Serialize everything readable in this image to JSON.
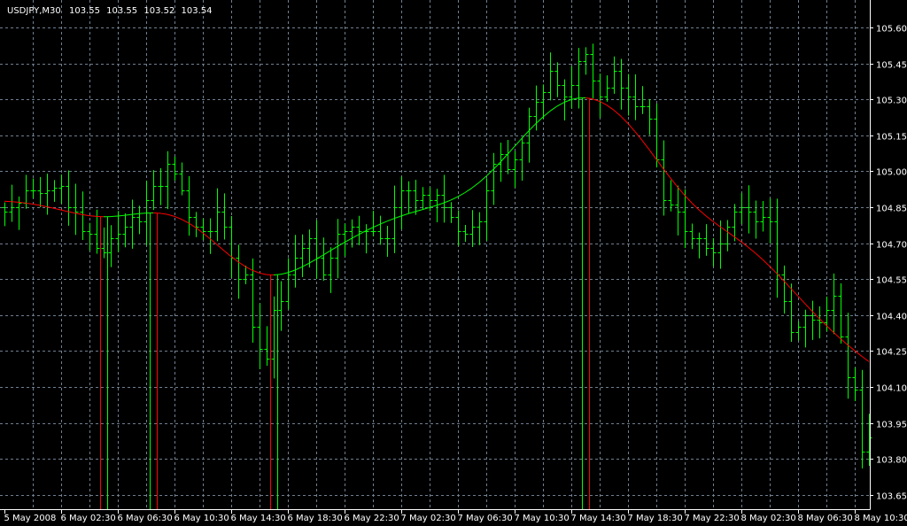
{
  "header": {
    "symbol": "USDJPY,M30",
    "open": "103.55",
    "high": "103.55",
    "low": "103.52",
    "close": "103.54"
  },
  "chart_data": {
    "type": "bar",
    "title": "USDJPY,M30",
    "ylim": [
      103.6,
      105.65
    ],
    "y_ticks": [
      "105.60",
      "105.45",
      "105.30",
      "105.15",
      "105.00",
      "104.85",
      "104.70",
      "104.55",
      "104.40",
      "104.25",
      "104.10",
      "103.95",
      "103.80",
      "103.65"
    ],
    "x_ticks": [
      "5 May 2008",
      "6 May 02:30",
      "6 May 06:30",
      "6 May 10:30",
      "6 May 14:30",
      "6 May 18:30",
      "6 May 22:30",
      "7 May 02:30",
      "7 May 06:30",
      "7 May 10:30",
      "7 May 14:30",
      "7 May 18:30",
      "7 May 22:30",
      "8 May 02:30",
      "8 May 06:30",
      "8 May 10:30"
    ],
    "bar_interval_minutes": 30,
    "grid": true,
    "colors": {
      "bars": "#00ff00",
      "ma_up": "#00ff00",
      "ma_down": "#ff0000",
      "grid": "#6f7f8f",
      "axis": "#ffffff"
    },
    "closes": [
      104.83,
      104.85,
      104.87,
      104.92,
      104.92,
      104.91,
      104.92,
      104.93,
      104.94,
      104.85,
      104.83,
      104.75,
      104.74,
      104.68,
      104.66,
      104.72,
      104.74,
      104.77,
      104.81,
      104.79,
      104.88,
      104.94,
      104.94,
      105.03,
      104.99,
      104.92,
      104.81,
      104.77,
      104.75,
      104.75,
      104.83,
      104.77,
      104.64,
      104.55,
      104.57,
      104.35,
      104.26,
      104.22,
      104.42,
      104.46,
      104.57,
      104.64,
      104.68,
      104.72,
      104.64,
      104.57,
      104.64,
      104.74,
      104.75,
      104.77,
      104.75,
      104.75,
      104.75,
      104.72,
      104.72,
      104.85,
      104.92,
      104.92,
      104.88,
      104.9,
      104.88,
      104.9,
      104.85,
      104.81,
      104.75,
      104.74,
      104.77,
      104.79,
      104.92,
      105.03,
      105.07,
      105.01,
      105.05,
      105.12,
      105.23,
      105.29,
      105.33,
      105.42,
      105.36,
      105.31,
      105.36,
      105.46,
      105.49,
      105.38,
      105.31,
      105.35,
      105.42,
      105.35,
      105.31,
      105.27,
      105.27,
      105.22,
      105.05,
      104.88,
      104.86,
      104.83,
      104.75,
      104.72,
      104.72,
      104.68,
      104.66,
      104.7,
      104.77,
      104.83,
      104.85,
      104.83,
      104.79,
      104.81,
      104.79,
      104.57,
      104.46,
      104.33,
      104.35,
      104.4,
      104.38,
      104.37,
      104.42,
      104.48,
      104.31,
      104.14,
      104.09,
      103.83,
      103.89
    ]
  }
}
